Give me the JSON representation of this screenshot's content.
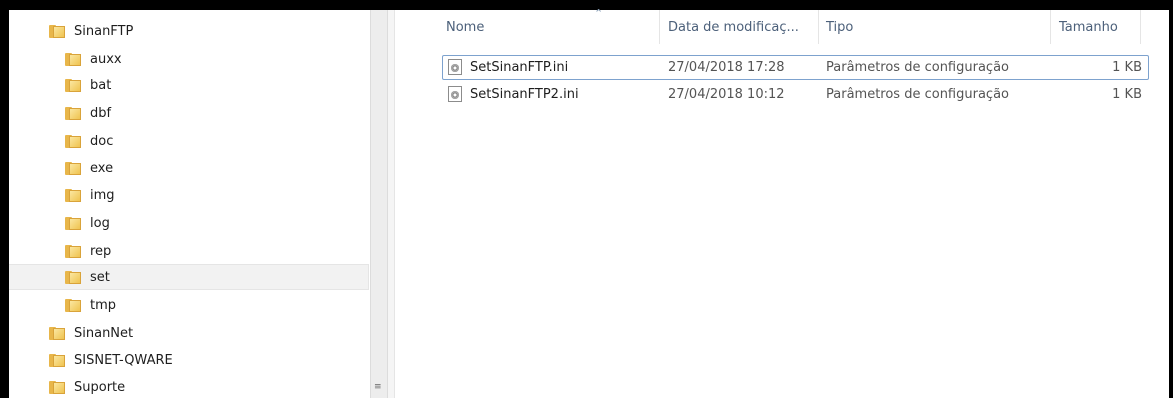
{
  "nav": {
    "items": [
      {
        "label": "SinanFTP",
        "level": 0,
        "selected": false
      },
      {
        "label": "auxx",
        "level": 1,
        "selected": false
      },
      {
        "label": "bat",
        "level": 1,
        "selected": false
      },
      {
        "label": "dbf",
        "level": 1,
        "selected": false
      },
      {
        "label": "doc",
        "level": 1,
        "selected": false
      },
      {
        "label": "exe",
        "level": 1,
        "selected": false
      },
      {
        "label": "img",
        "level": 1,
        "selected": false
      },
      {
        "label": "log",
        "level": 1,
        "selected": false
      },
      {
        "label": "rep",
        "level": 1,
        "selected": false
      },
      {
        "label": "set",
        "level": 1,
        "selected": true
      },
      {
        "label": "tmp",
        "level": 1,
        "selected": false
      },
      {
        "label": "SinanNet",
        "level": 0,
        "selected": false
      },
      {
        "label": "SISNET-QWARE",
        "level": 0,
        "selected": false
      },
      {
        "label": "Suporte",
        "level": 0,
        "selected": false
      }
    ]
  },
  "columns": {
    "name": "Nome",
    "date": "Data de modificaç...",
    "type": "Tipo",
    "size": "Tamanho"
  },
  "files": [
    {
      "name": "SetSinanFTP.ini",
      "date": "27/04/2018 17:28",
      "type": "Parâmetros de configuração",
      "size": "1 KB"
    },
    {
      "name": "SetSinanFTP2.ini",
      "date": "27/04/2018 10:12",
      "type": "Parâmetros de configuração",
      "size": "1 KB"
    }
  ],
  "colors": {
    "header_text": "#4c607a",
    "focus_border": "#7da2ce",
    "selection_bg": "#f2f2f2"
  }
}
